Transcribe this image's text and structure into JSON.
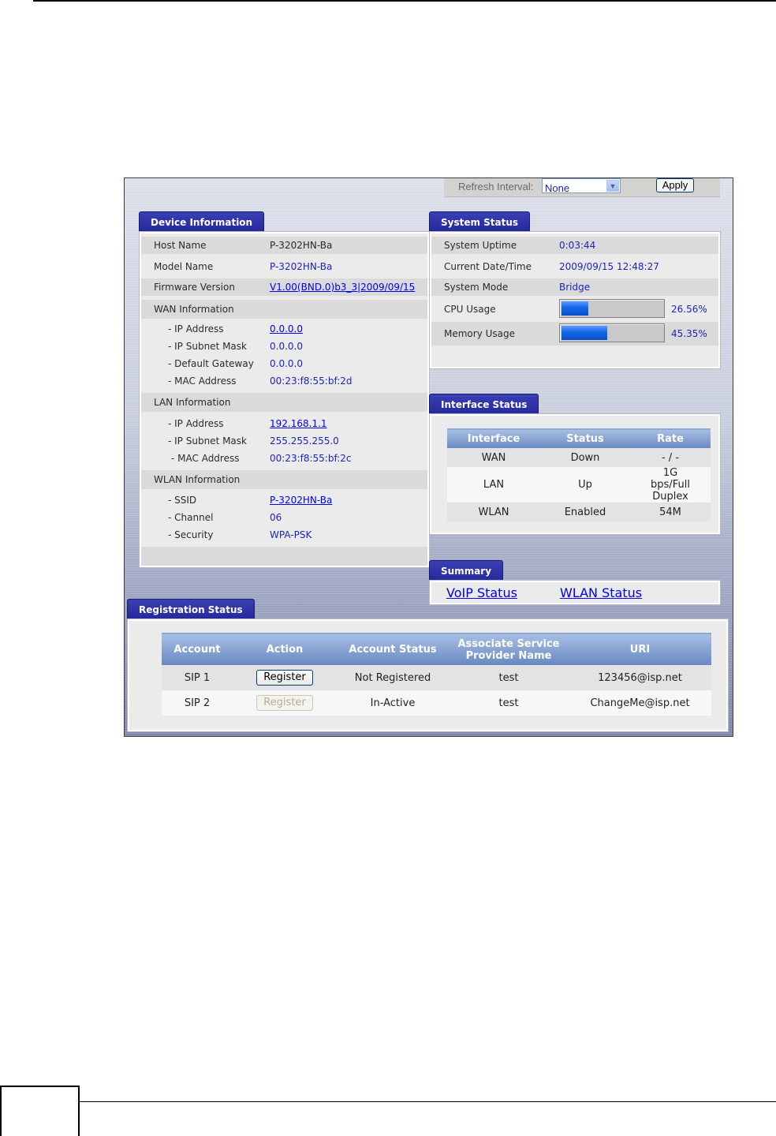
{
  "refresh": {
    "label": "Refresh Interval:",
    "selected": "None",
    "apply_label": "Apply"
  },
  "device_info": {
    "tab": "Device Information",
    "host_name": {
      "label": "Host Name",
      "value": "P-3202HN-Ba"
    },
    "model_name": {
      "label": "Model Name",
      "value": "P-3202HN-Ba"
    },
    "firmware": {
      "label": "Firmware Version",
      "value": "V1.00(BND.0)b3_3|2009/09/15"
    },
    "wan": {
      "header": "WAN Information",
      "ip": {
        "label": "- IP Address",
        "value": "0.0.0.0"
      },
      "mask": {
        "label": "- IP Subnet Mask",
        "value": "0.0.0.0"
      },
      "gateway": {
        "label": "- Default Gateway",
        "value": "0.0.0.0"
      },
      "mac": {
        "label": "- MAC Address",
        "value": "00:23:f8:55:bf:2d"
      }
    },
    "lan": {
      "header": "LAN Information",
      "ip": {
        "label": "- IP Address",
        "value": "192.168.1.1"
      },
      "mask": {
        "label": "- IP Subnet Mask",
        "value": "255.255.255.0"
      },
      "mac": {
        "label": "- MAC Address",
        "value": "00:23:f8:55:bf:2c"
      }
    },
    "wlan": {
      "header": "WLAN Information",
      "ssid": {
        "label": "- SSID",
        "value": "P-3202HN-Ba"
      },
      "channel": {
        "label": "- Channel",
        "value": "06"
      },
      "security": {
        "label": "- Security",
        "value": "WPA-PSK"
      }
    }
  },
  "system_status": {
    "tab": "System Status",
    "uptime": {
      "label": "System Uptime",
      "value": "0:03:44"
    },
    "datetime": {
      "label": "Current Date/Time",
      "value": "2009/09/15 12:48:27"
    },
    "mode": {
      "label": "System Mode",
      "value": "Bridge"
    },
    "cpu": {
      "label": "CPU Usage",
      "value": "26.56%",
      "percent": 26.56
    },
    "memory": {
      "label": "Memory Usage",
      "value": "45.35%",
      "percent": 45.35
    }
  },
  "interface_status": {
    "tab": "Interface Status",
    "headers": [
      "Interface",
      "Status",
      "Rate"
    ],
    "rows": [
      [
        "WAN",
        "Down",
        "- / -"
      ],
      [
        "LAN",
        "Up",
        "1G bps/Full Duplex"
      ],
      [
        "WLAN",
        "Enabled",
        "54M"
      ]
    ]
  },
  "summary": {
    "tab": "Summary",
    "voip_link": "VoIP Status",
    "wlan_link": "WLAN Status"
  },
  "registration": {
    "tab": "Registration Status",
    "headers": [
      "Account",
      "Action",
      "Account Status",
      "Associate Service Provider Name",
      "URI"
    ],
    "rows": [
      {
        "account": "SIP 1",
        "action": "Register",
        "status": "Not Registered",
        "provider": "test",
        "uri": "123456@isp.net"
      },
      {
        "account": "SIP 2",
        "action": "Register",
        "status": "In-Active",
        "provider": "test",
        "uri": "ChangeMe@isp.net"
      }
    ]
  }
}
